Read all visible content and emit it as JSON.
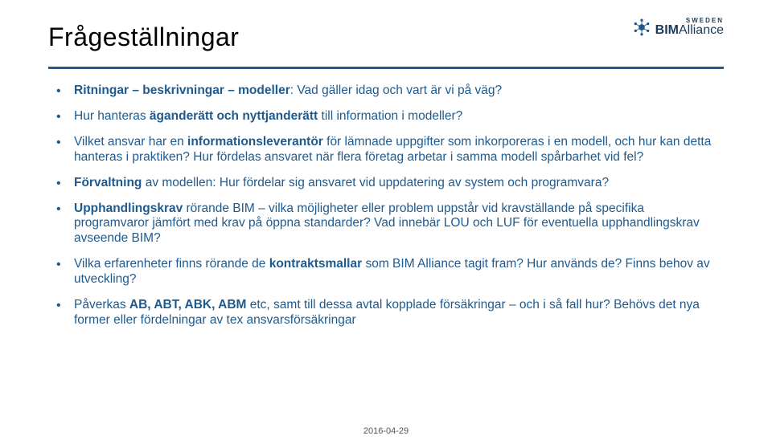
{
  "header": {
    "title": "Frågeställningar",
    "logo": {
      "sweden": "SWEDEN",
      "brand_bold": "BIM",
      "brand_rest": "Alliance"
    }
  },
  "bullets": [
    {
      "html": "<b>Ritningar – beskrivningar – modeller</b>: Vad gäller idag och vart är vi på väg?"
    },
    {
      "html": "Hur hanteras <b>äganderätt och nyttjanderätt</b> till information i modeller?"
    },
    {
      "html": "Vilket ansvar har en <b>informationsleverantör</b> för lämnade uppgifter som inkorporeras i en modell, och hur kan detta hanteras i praktiken? Hur fördelas ansvaret när flera företag arbetar i samma modell spårbarhet vid fel?"
    },
    {
      "html": "<b>Förvaltning</b> av modellen: Hur fördelar sig ansvaret vid uppdatering av system och programvara?"
    },
    {
      "html": "<b>Upphandlingskrav</b> rörande BIM – vilka möjligheter eller problem uppstår vid kravställande på specifika programvaror jämfört med krav på öppna standarder? Vad innebär LOU och LUF för eventuella upphandlingskrav avseende BIM?"
    },
    {
      "html": "Vilka erfarenheter finns rörande de <b>kontraktsmallar</b> som BIM Alliance tagit fram? Hur används de? Finns behov av utveckling?"
    },
    {
      "html": "Påverkas <b>AB, ABT, ABK, ABM</b> etc, samt till dessa avtal kopplade försäkringar – och i så fall hur? Behövs det nya former eller fördelningar av tex ansvarsförsäkringar"
    }
  ],
  "footer": {
    "date": "2016-04-29"
  }
}
